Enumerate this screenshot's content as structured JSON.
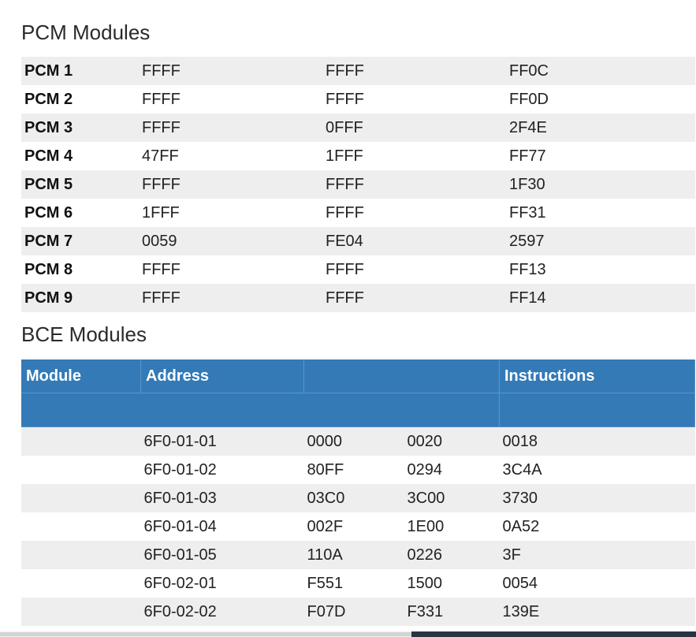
{
  "pcm": {
    "title": "PCM Modules",
    "rows": [
      {
        "name": "PCM 1",
        "v1": "FFFF",
        "v2": "FFFF",
        "v3": "FF0C"
      },
      {
        "name": "PCM 2",
        "v1": "FFFF",
        "v2": "FFFF",
        "v3": "FF0D"
      },
      {
        "name": "PCM 3",
        "v1": "FFFF",
        "v2": "0FFF",
        "v3": "2F4E"
      },
      {
        "name": "PCM 4",
        "v1": "47FF",
        "v2": "1FFF",
        "v3": "FF77"
      },
      {
        "name": "PCM 5",
        "v1": "FFFF",
        "v2": "FFFF",
        "v3": "1F30"
      },
      {
        "name": "PCM 6",
        "v1": "1FFF",
        "v2": "FFFF",
        "v3": "FF31"
      },
      {
        "name": "PCM 7",
        "v1": "0059",
        "v2": "FE04",
        "v3": "2597"
      },
      {
        "name": "PCM 8",
        "v1": "FFFF",
        "v2": "FFFF",
        "v3": "FF13"
      },
      {
        "name": "PCM 9",
        "v1": "FFFF",
        "v2": "FFFF",
        "v3": "FF14"
      }
    ]
  },
  "bce": {
    "title": "BCE Modules",
    "headers": {
      "module": "Module",
      "address": "Address",
      "instructions": "Instructions"
    },
    "rows": [
      {
        "module": "",
        "address": "6F0-01-01",
        "i1": "0000",
        "i2": "0020",
        "i3": "0018"
      },
      {
        "module": "",
        "address": "6F0-01-02",
        "i1": "80FF",
        "i2": "0294",
        "i3": "3C4A"
      },
      {
        "module": "",
        "address": "6F0-01-03",
        "i1": "03C0",
        "i2": "3C00",
        "i3": "3730"
      },
      {
        "module": "",
        "address": "6F0-01-04",
        "i1": "002F",
        "i2": "1E00",
        "i3": "0A52"
      },
      {
        "module": "",
        "address": "6F0-01-05",
        "i1": "110A",
        "i2": "0226",
        "i3": "3F"
      },
      {
        "module": "",
        "address": "6F0-02-01",
        "i1": "F551",
        "i2": "1500",
        "i3": "0054"
      },
      {
        "module": "",
        "address": "6F0-02-02",
        "i1": "F07D",
        "i2": "F331",
        "i3": "139E"
      }
    ]
  },
  "colors": {
    "header_bg": "#337ab7",
    "stripe": "#eeeeee"
  }
}
